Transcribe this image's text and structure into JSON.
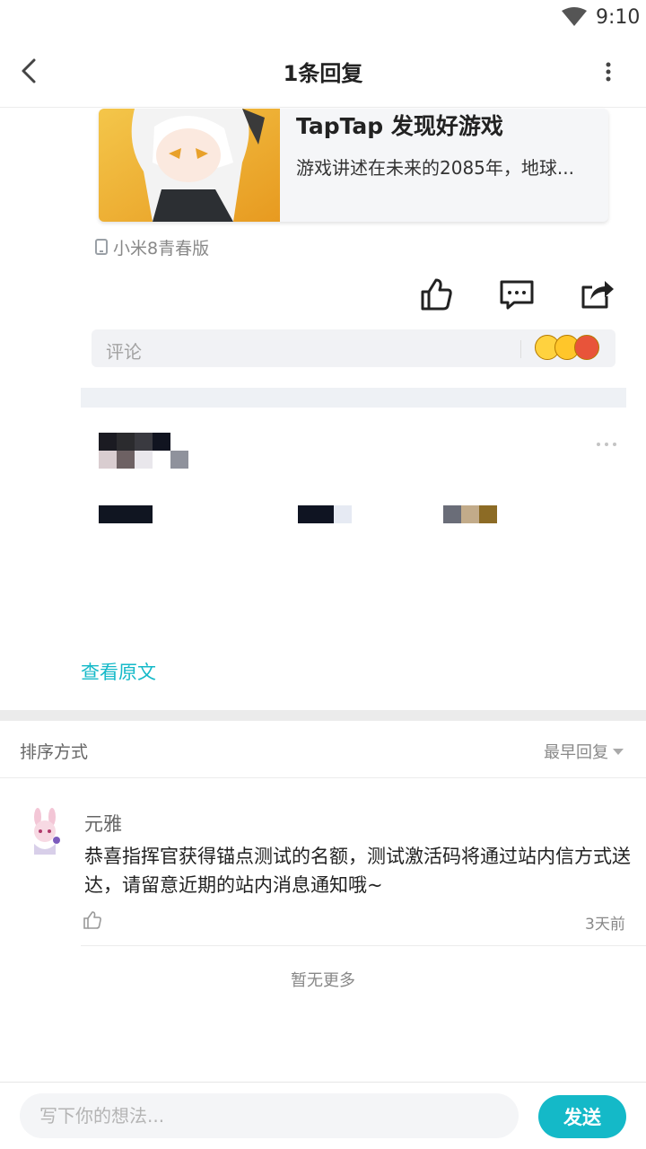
{
  "status_bar": {
    "time": "9:10"
  },
  "header": {
    "title": "1条回复"
  },
  "shared_card": {
    "title": "TapTap 发现好游戏",
    "description": "游戏讲述在未来的2085年，地球..."
  },
  "post": {
    "device": "小米8青春版",
    "comment_placeholder": "评论",
    "view_original": "查看原文"
  },
  "sort": {
    "label": "排序方式",
    "value": "最早回复"
  },
  "reply": {
    "author": "元雅",
    "content": "恭喜指挥官获得锚点测试的名额，测试激活码将通过站内信方式送达，请留意近期的站内消息通知哦~",
    "time": "3天前"
  },
  "footer_note": "暂无更多",
  "input": {
    "placeholder": "写下你的想法...",
    "send_label": "发送"
  },
  "colors": {
    "accent": "#14b9c8"
  },
  "icons": {
    "back": "back-arrow-icon",
    "more": "more-vertical-icon",
    "like": "thumbs-up-icon",
    "comment": "comment-icon",
    "share": "share-icon"
  }
}
